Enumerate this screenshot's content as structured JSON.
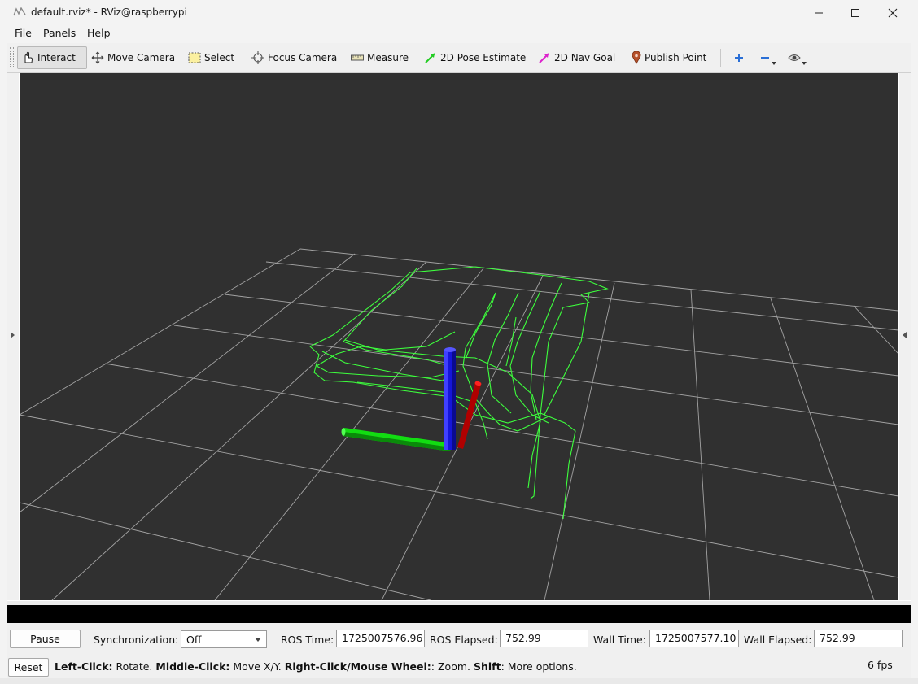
{
  "window": {
    "title": "default.rviz* - RViz@raspberrypi"
  },
  "menu": {
    "file": "File",
    "panels": "Panels",
    "help": "Help"
  },
  "toolbar": {
    "interact": "Interact",
    "move_camera": "Move Camera",
    "select": "Select",
    "focus_camera": "Focus Camera",
    "measure": "Measure",
    "pose_estimate": "2D Pose Estimate",
    "nav_goal": "2D Nav Goal",
    "publish_point": "Publish Point"
  },
  "time": {
    "pause_label": "Pause",
    "sync_label": "Synchronization:",
    "sync_value": "Off",
    "ros_time_label": "ROS Time:",
    "ros_time": "1725007576.96",
    "ros_elapsed_label": "ROS Elapsed:",
    "ros_elapsed": "752.99",
    "wall_time_label": "Wall Time:",
    "wall_time": "1725007577.10",
    "wall_elapsed_label": "Wall Elapsed:",
    "wall_elapsed": "752.99"
  },
  "status": {
    "reset_label": "Reset",
    "hint_left_key": "Left-Click:",
    "hint_left_val": " Rotate. ",
    "hint_middle_key": "Middle-Click:",
    "hint_middle_val": " Move X/Y. ",
    "hint_right_key": "Right-Click/Mouse Wheel:",
    "hint_right_val": ": Zoom. ",
    "hint_shift_key": "Shift",
    "hint_shift_val": ": More options.",
    "fps": "6 fps"
  },
  "colors": {
    "viewport_bg": "#303030",
    "grid": "#a0a0a0",
    "path": "#33ff33",
    "axis_x": "#c00000",
    "axis_y": "#00cc00",
    "axis_z": "#1010dd"
  }
}
